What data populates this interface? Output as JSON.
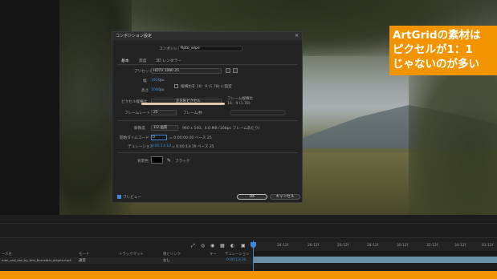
{
  "caption": {
    "line1": "ArtGridの素材は",
    "line2": "ピクセルが1：1",
    "line3": "じゃないのが多い"
  },
  "dialog": {
    "title": "コンポジション設定",
    "close": "×",
    "comp_name_label": "コンポジション名",
    "comp_name_value": "Rpto_wipe",
    "tabs": [
      "基本",
      "高度",
      "3D レンダラー"
    ],
    "active_tab": "基本",
    "preset_label": "プリセット",
    "preset_value": "HDTV 1080 25",
    "width_label": "幅",
    "width_value": "1920",
    "width_unit": "px",
    "height_label": "高さ",
    "height_value": "1080",
    "height_unit": "px",
    "lock_aspect_label": "縦横比を 16：9 (1.78) に固定",
    "pixel_aspect_label": "ピクセル縦横比",
    "pixel_aspect_value": "正方形ピクセル",
    "frame_aspect_label": "フレーム縦横比",
    "frame_aspect_value": "16：9 (1.78)",
    "frame_rate_label": "フレームレート",
    "frame_rate_value": "25",
    "frame_rate_unit": "フレーム/秒",
    "resolution_label": "解像度",
    "resolution_value": "1/2 画質",
    "resolution_note": "960 x 540、4.0 MB (16bpc フレームあたり)",
    "start_tc_label": "開始タイムコード",
    "start_tc_value": "0",
    "start_tc_note": "= 0:00:00:00 ベース 25",
    "duration_label": "デュレーション",
    "duration_value": "0:00:13:19",
    "duration_note": "= 0:00:13:19 ベース 25",
    "bg_color_label": "背景色",
    "bg_color_name": "ブラック",
    "preview_label": "プレビュー",
    "ok_label": "OK",
    "cancel_label": "キャンセル"
  },
  "timeline": {
    "headers": {
      "source": "ース名",
      "mode": "モード",
      "trkmat": "トラックマット",
      "parent": "親とリンク",
      "key": "キー",
      "duration": "デュレーション"
    },
    "layer": {
      "name": "man_and_aoc_by_Ami_Bornstein_Artgrid.mp4",
      "mode": "通常",
      "parent": "なし",
      "duration": "0:00:13:19"
    },
    "ticks": [
      "24:12f",
      "28:12f",
      "26:12f",
      "28:12f",
      "30:12f",
      "32:12f",
      "34:12f",
      "01:12f"
    ]
  },
  "colors": {
    "accent_orange": "#f29400",
    "ae_blue": "#3d8bd6"
  }
}
